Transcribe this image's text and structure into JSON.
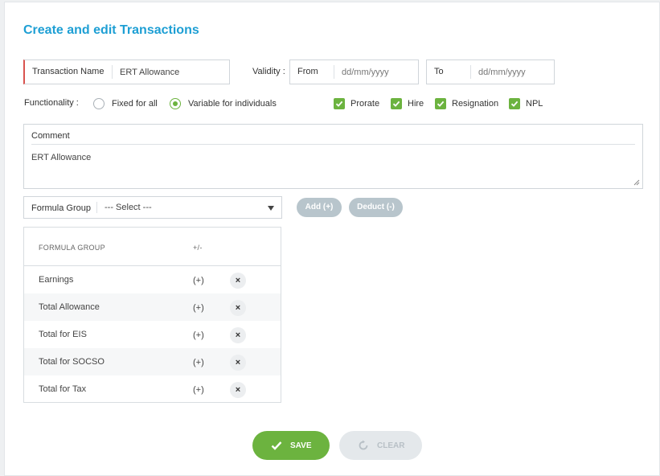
{
  "page": {
    "title": "Create and edit Transactions"
  },
  "transaction": {
    "label": "Transaction Name",
    "value": "ERT Allowance"
  },
  "validity": {
    "label": "Validity :",
    "from_label": "From",
    "from_placeholder": "dd/mm/yyyy",
    "to_label": "To",
    "to_placeholder": "dd/mm/yyyy"
  },
  "functionality": {
    "label": "Functionality :",
    "options": [
      {
        "label": "Fixed for all",
        "selected": false
      },
      {
        "label": "Variable for individuals",
        "selected": true
      }
    ],
    "checkboxes": [
      {
        "label": "Prorate",
        "checked": true
      },
      {
        "label": "Hire",
        "checked": true
      },
      {
        "label": "Resignation",
        "checked": true
      },
      {
        "label": "NPL",
        "checked": true
      }
    ]
  },
  "comment": {
    "label": "Comment",
    "value": "ERT Allowance"
  },
  "formula_group": {
    "label": "Formula Group",
    "selected": "--- Select ---",
    "add_label": "Add (+)",
    "deduct_label": "Deduct (-)"
  },
  "table": {
    "headers": [
      "FORMULA GROUP",
      "+/-"
    ],
    "rows": [
      {
        "name": "Earnings",
        "sign": "(+)"
      },
      {
        "name": "Total Allowance",
        "sign": "(+)"
      },
      {
        "name": "Total for EIS",
        "sign": "(+)"
      },
      {
        "name": "Total for SOCSO",
        "sign": "(+)"
      },
      {
        "name": "Total for Tax",
        "sign": "(+)"
      }
    ],
    "remove_glyph": "×"
  },
  "actions": {
    "save_label": "SAVE",
    "clear_label": "CLEAR"
  },
  "colors": {
    "accent": "#1e9fd4",
    "green": "#6cb33f",
    "required": "#d9534f"
  }
}
